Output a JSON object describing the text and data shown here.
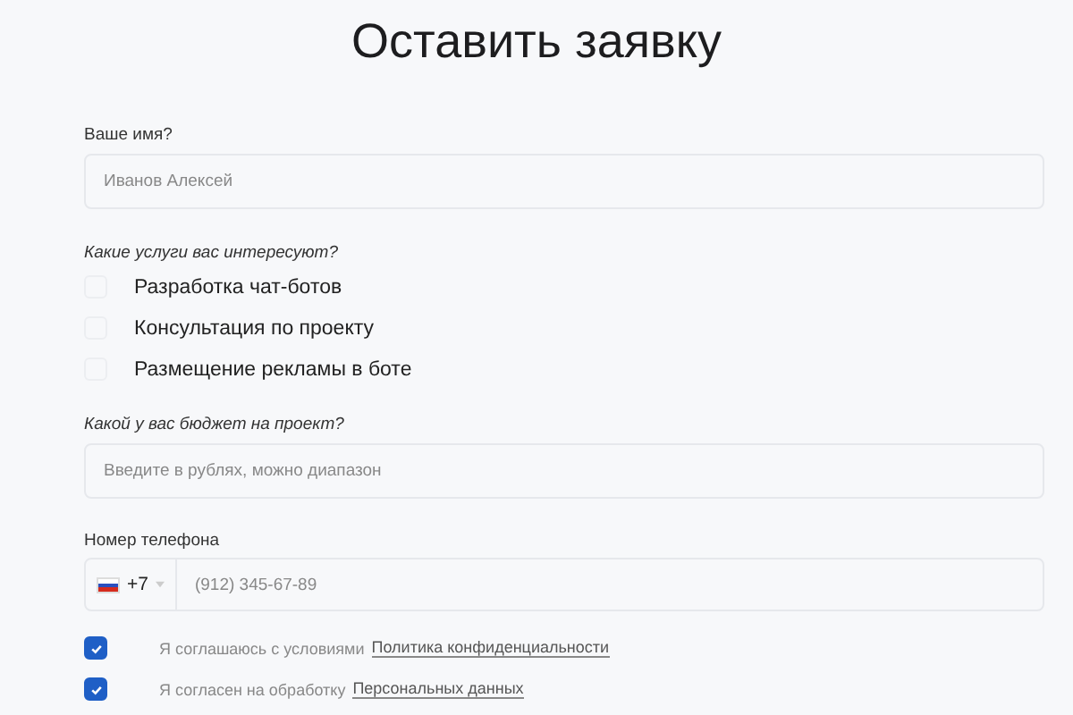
{
  "title": "Оставить заявку",
  "name_field": {
    "label": "Ваше имя?",
    "placeholder": "Иванов Алексей"
  },
  "services": {
    "label": "Какие услуги вас интересуют?",
    "options": [
      {
        "label": "Разработка чат-ботов",
        "checked": false
      },
      {
        "label": "Консультация по проекту",
        "checked": false
      },
      {
        "label": "Размещение рекламы в боте",
        "checked": false
      }
    ]
  },
  "budget_field": {
    "label": "Какой у вас бюджет на проект?",
    "placeholder": "Введите в рублях, можно диапазон"
  },
  "phone_field": {
    "label": "Номер телефона",
    "country_code": "+7",
    "placeholder": "(912) 345-67-89"
  },
  "consents": [
    {
      "text": "Я соглашаюсь с условиями",
      "link": "Политика конфиденциальности",
      "checked": true
    },
    {
      "text": "Я согласен на обработку",
      "link": "Персональных данных",
      "checked": true
    }
  ]
}
